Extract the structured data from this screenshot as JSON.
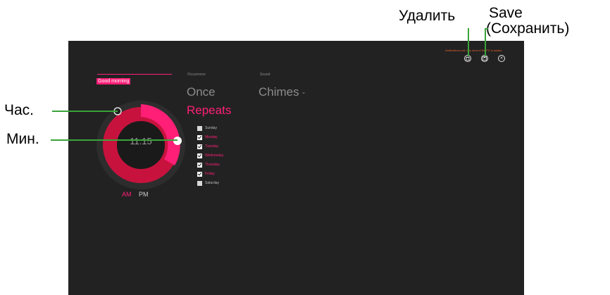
{
  "callouts": {
    "delete": "Удалить",
    "save_line1": "Save",
    "save_line2": "(Сохранить)",
    "hour": "Час.",
    "minute": "Мин."
  },
  "alarm": {
    "name": "Good morning",
    "time": "11:15",
    "am": "AM",
    "pm": "PM",
    "selected_period": "AM"
  },
  "occurrence": {
    "label": "Occurrence",
    "options": [
      "Once",
      "Repeats"
    ],
    "selected": "Repeats"
  },
  "sound": {
    "label": "Sound",
    "value": "Chimes"
  },
  "days": [
    {
      "label": "Sunday",
      "checked": false
    },
    {
      "label": "Monday",
      "checked": true
    },
    {
      "label": "Tuesday",
      "checked": true
    },
    {
      "label": "Wednesday",
      "checked": true
    },
    {
      "label": "Thursday",
      "checked": true
    },
    {
      "label": "Friday",
      "checked": true
    },
    {
      "label": "Saturday",
      "checked": false
    }
  ],
  "notice": "Notifications will only show if the PC is awake",
  "icons": {
    "delete": "trash-icon",
    "save": "save-icon",
    "close": "close-icon"
  },
  "colors": {
    "accent": "#ff1f77",
    "accent_dark": "#c8123e",
    "screen_bg": "#222222",
    "callout_line": "#3aa33a"
  }
}
